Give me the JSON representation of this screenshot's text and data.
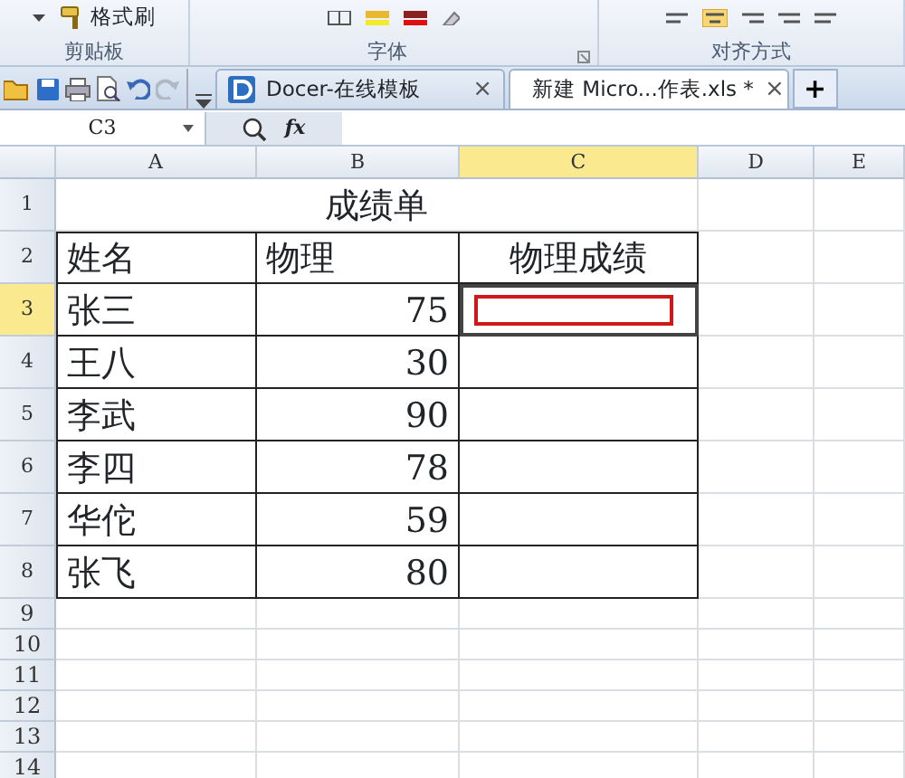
{
  "ribbon": {
    "format_painter": "格式刷",
    "groups": [
      "剪贴板",
      "字体",
      "对齐方式"
    ]
  },
  "tabs": [
    {
      "kind": "docer",
      "label": "Docer-在线模板",
      "close": "×",
      "selected": false
    },
    {
      "kind": "sheet",
      "label": "新建 Micro...作表.xls *",
      "close": "×",
      "selected": true
    }
  ],
  "new_tab": "+",
  "formula_bar": {
    "name_box": "C3",
    "fx": "fx"
  },
  "columns": [
    {
      "label": "A",
      "selected": false
    },
    {
      "label": "B",
      "selected": false
    },
    {
      "label": "C",
      "selected": true
    },
    {
      "label": "D",
      "selected": false
    },
    {
      "label": "E",
      "selected": false
    }
  ],
  "rows": [
    {
      "header": "1",
      "kind": "title",
      "selected": false,
      "marked": false,
      "cells": [
        "成绩单"
      ]
    },
    {
      "header": "2",
      "kind": "head",
      "selected": false,
      "marked": false,
      "cells": [
        "姓名",
        "物理",
        "物理成绩"
      ]
    },
    {
      "header": "3",
      "kind": "data",
      "selected": true,
      "marked": true,
      "cells": [
        "张三",
        "75"
      ]
    },
    {
      "header": "4",
      "kind": "data",
      "selected": false,
      "marked": false,
      "cells": [
        "王八",
        "30"
      ]
    },
    {
      "header": "5",
      "kind": "data",
      "selected": false,
      "marked": false,
      "cells": [
        "李武",
        "90"
      ]
    },
    {
      "header": "6",
      "kind": "data",
      "selected": false,
      "marked": false,
      "cells": [
        "李四",
        "78"
      ]
    },
    {
      "header": "7",
      "kind": "data",
      "selected": false,
      "marked": false,
      "cells": [
        "华佗",
        "59"
      ]
    },
    {
      "header": "8",
      "kind": "data",
      "selected": false,
      "marked": false,
      "cells": [
        "张飞",
        "80"
      ]
    },
    {
      "header": "9",
      "kind": "blank",
      "selected": false,
      "marked": false
    },
    {
      "header": "10",
      "kind": "blank",
      "selected": false,
      "marked": false
    },
    {
      "header": "11",
      "kind": "blank",
      "selected": false,
      "marked": false
    },
    {
      "header": "12",
      "kind": "blank",
      "selected": false,
      "marked": false
    },
    {
      "header": "13",
      "kind": "blank",
      "selected": false,
      "marked": false
    },
    {
      "header": "14",
      "kind": "blank",
      "selected": false,
      "marked": false
    }
  ]
}
